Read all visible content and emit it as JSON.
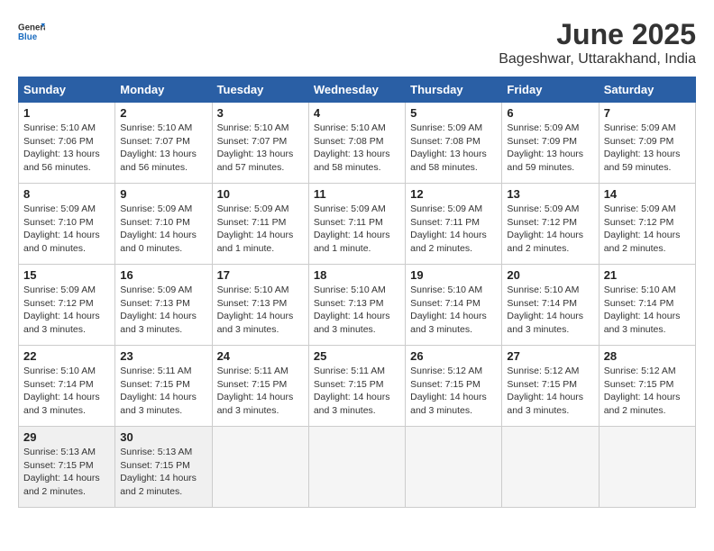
{
  "header": {
    "logo_general": "General",
    "logo_blue": "Blue",
    "month_title": "June 2025",
    "location": "Bageshwar, Uttarakhand, India"
  },
  "weekdays": [
    "Sunday",
    "Monday",
    "Tuesday",
    "Wednesday",
    "Thursday",
    "Friday",
    "Saturday"
  ],
  "weeks": [
    [
      {
        "day": "1",
        "sunrise": "5:10 AM",
        "sunset": "7:06 PM",
        "daylight": "13 hours and 56 minutes."
      },
      {
        "day": "2",
        "sunrise": "5:10 AM",
        "sunset": "7:07 PM",
        "daylight": "13 hours and 56 minutes."
      },
      {
        "day": "3",
        "sunrise": "5:10 AM",
        "sunset": "7:07 PM",
        "daylight": "13 hours and 57 minutes."
      },
      {
        "day": "4",
        "sunrise": "5:10 AM",
        "sunset": "7:08 PM",
        "daylight": "13 hours and 58 minutes."
      },
      {
        "day": "5",
        "sunrise": "5:09 AM",
        "sunset": "7:08 PM",
        "daylight": "13 hours and 58 minutes."
      },
      {
        "day": "6",
        "sunrise": "5:09 AM",
        "sunset": "7:09 PM",
        "daylight": "13 hours and 59 minutes."
      },
      {
        "day": "7",
        "sunrise": "5:09 AM",
        "sunset": "7:09 PM",
        "daylight": "13 hours and 59 minutes."
      }
    ],
    [
      {
        "day": "8",
        "sunrise": "5:09 AM",
        "sunset": "7:10 PM",
        "daylight": "14 hours and 0 minutes."
      },
      {
        "day": "9",
        "sunrise": "5:09 AM",
        "sunset": "7:10 PM",
        "daylight": "14 hours and 0 minutes."
      },
      {
        "day": "10",
        "sunrise": "5:09 AM",
        "sunset": "7:11 PM",
        "daylight": "14 hours and 1 minute."
      },
      {
        "day": "11",
        "sunrise": "5:09 AM",
        "sunset": "7:11 PM",
        "daylight": "14 hours and 1 minute."
      },
      {
        "day": "12",
        "sunrise": "5:09 AM",
        "sunset": "7:11 PM",
        "daylight": "14 hours and 2 minutes."
      },
      {
        "day": "13",
        "sunrise": "5:09 AM",
        "sunset": "7:12 PM",
        "daylight": "14 hours and 2 minutes."
      },
      {
        "day": "14",
        "sunrise": "5:09 AM",
        "sunset": "7:12 PM",
        "daylight": "14 hours and 2 minutes."
      }
    ],
    [
      {
        "day": "15",
        "sunrise": "5:09 AM",
        "sunset": "7:12 PM",
        "daylight": "14 hours and 3 minutes."
      },
      {
        "day": "16",
        "sunrise": "5:09 AM",
        "sunset": "7:13 PM",
        "daylight": "14 hours and 3 minutes."
      },
      {
        "day": "17",
        "sunrise": "5:10 AM",
        "sunset": "7:13 PM",
        "daylight": "14 hours and 3 minutes."
      },
      {
        "day": "18",
        "sunrise": "5:10 AM",
        "sunset": "7:13 PM",
        "daylight": "14 hours and 3 minutes."
      },
      {
        "day": "19",
        "sunrise": "5:10 AM",
        "sunset": "7:14 PM",
        "daylight": "14 hours and 3 minutes."
      },
      {
        "day": "20",
        "sunrise": "5:10 AM",
        "sunset": "7:14 PM",
        "daylight": "14 hours and 3 minutes."
      },
      {
        "day": "21",
        "sunrise": "5:10 AM",
        "sunset": "7:14 PM",
        "daylight": "14 hours and 3 minutes."
      }
    ],
    [
      {
        "day": "22",
        "sunrise": "5:10 AM",
        "sunset": "7:14 PM",
        "daylight": "14 hours and 3 minutes."
      },
      {
        "day": "23",
        "sunrise": "5:11 AM",
        "sunset": "7:15 PM",
        "daylight": "14 hours and 3 minutes."
      },
      {
        "day": "24",
        "sunrise": "5:11 AM",
        "sunset": "7:15 PM",
        "daylight": "14 hours and 3 minutes."
      },
      {
        "day": "25",
        "sunrise": "5:11 AM",
        "sunset": "7:15 PM",
        "daylight": "14 hours and 3 minutes."
      },
      {
        "day": "26",
        "sunrise": "5:12 AM",
        "sunset": "7:15 PM",
        "daylight": "14 hours and 3 minutes."
      },
      {
        "day": "27",
        "sunrise": "5:12 AM",
        "sunset": "7:15 PM",
        "daylight": "14 hours and 3 minutes."
      },
      {
        "day": "28",
        "sunrise": "5:12 AM",
        "sunset": "7:15 PM",
        "daylight": "14 hours and 2 minutes."
      }
    ],
    [
      {
        "day": "29",
        "sunrise": "5:13 AM",
        "sunset": "7:15 PM",
        "daylight": "14 hours and 2 minutes."
      },
      {
        "day": "30",
        "sunrise": "5:13 AM",
        "sunset": "7:15 PM",
        "daylight": "14 hours and 2 minutes."
      },
      null,
      null,
      null,
      null,
      null
    ]
  ],
  "labels": {
    "sunrise_prefix": "Sunrise: ",
    "sunset_prefix": "Sunset: ",
    "daylight_prefix": "Daylight: "
  }
}
